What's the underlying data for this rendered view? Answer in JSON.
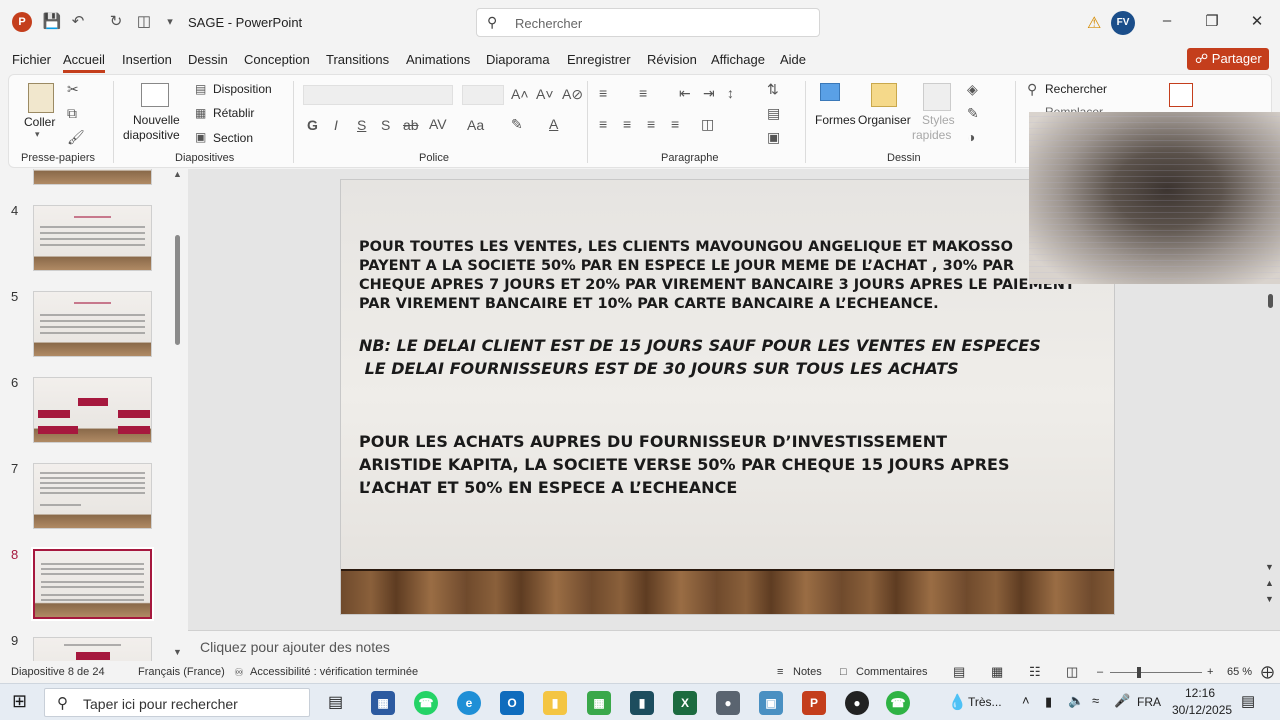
{
  "titlebar": {
    "app_icon": "powerpoint-logo",
    "doc_title": "SAGE  -  PowerPoint",
    "search_placeholder": "Rechercher",
    "user_initials": "FV"
  },
  "menu": {
    "tabs": [
      "Fichier",
      "Accueil",
      "Insertion",
      "Dessin",
      "Conception",
      "Transitions",
      "Animations",
      "Diaporama",
      "Enregistrer",
      "Révision",
      "Affichage",
      "Aide"
    ],
    "share_label": "Partager"
  },
  "ribbon": {
    "paste_label": "Coller",
    "clipboard_group": "Presse-papiers",
    "new_slide_line1": "Nouvelle",
    "new_slide_line2": "diapositive",
    "layout_label": "Disposition",
    "reset_label": "Rétablir",
    "section_label": "Section",
    "slides_group": "Diapositives",
    "font_group": "Police",
    "paragraph_group": "Paragraphe",
    "shapes_label": "Formes",
    "arrange_label": "Organiser",
    "styles_line1": "Styles",
    "styles_line2": "rapides",
    "drawing_group": "Dessin",
    "find_label": "Rechercher",
    "replace_label": "Remplacer"
  },
  "thumbnails": {
    "numbers": [
      "4",
      "5",
      "6",
      "7",
      "8",
      "9"
    ],
    "selected": "8"
  },
  "slide": {
    "para1": [
      "POUR TOUTES LES VENTES, LES CLIENTS MAVOUNGOU ANGELIQUE ET MAKOSSO",
      "PAYENT A LA SOCIETE  50% PAR EN ESPECE  LE JOUR MEME DE L’ACHAT , 30% PAR",
      "CHEQUE APRES 7 JOURS ET 20% PAR VIREMENT BANCAIRE 3 JOURS APRES LE PAIEMENT",
      "PAR VIREMENT BANCAIRE ET 10% PAR CARTE BANCAIRE  A L’ECHEANCE."
    ],
    "para2": [
      "NB: LE DELAI CLIENT EST DE 15 JOURS SAUF POUR LES VENTES EN ESPECES",
      " LE DELAI FOURNISSEURS EST DE 30 JOURS SUR TOUS LES ACHATS"
    ],
    "para3": [
      "POUR LES  ACHATS AUPRES DU FOURNISSEUR D’INVESTISSEMENT",
      "ARISTIDE KAPITA, LA SOCIETE VERSE 50% PAR CHEQUE 15 JOURS APRES",
      "L’ACHAT ET 50% EN ESPECE A L’ECHEANCE"
    ]
  },
  "notes_placeholder": "Cliquez pour ajouter des notes",
  "status": {
    "slide_counter": "Diapositive 8 de 24",
    "language": "Français (France)",
    "accessibility": "Accessibilité : vérification terminée",
    "notes_btn": "Notes",
    "comments_btn": "Commentaires",
    "zoom": "65 %"
  },
  "taskbar": {
    "search_placeholder": "Taper ici pour rechercher",
    "weather": "Très...",
    "lang": "FRA",
    "time": "12:16",
    "date": "30/12/2025"
  },
  "colors": {
    "accent": "#c43e1c",
    "thumb_red": "#a6183e"
  }
}
